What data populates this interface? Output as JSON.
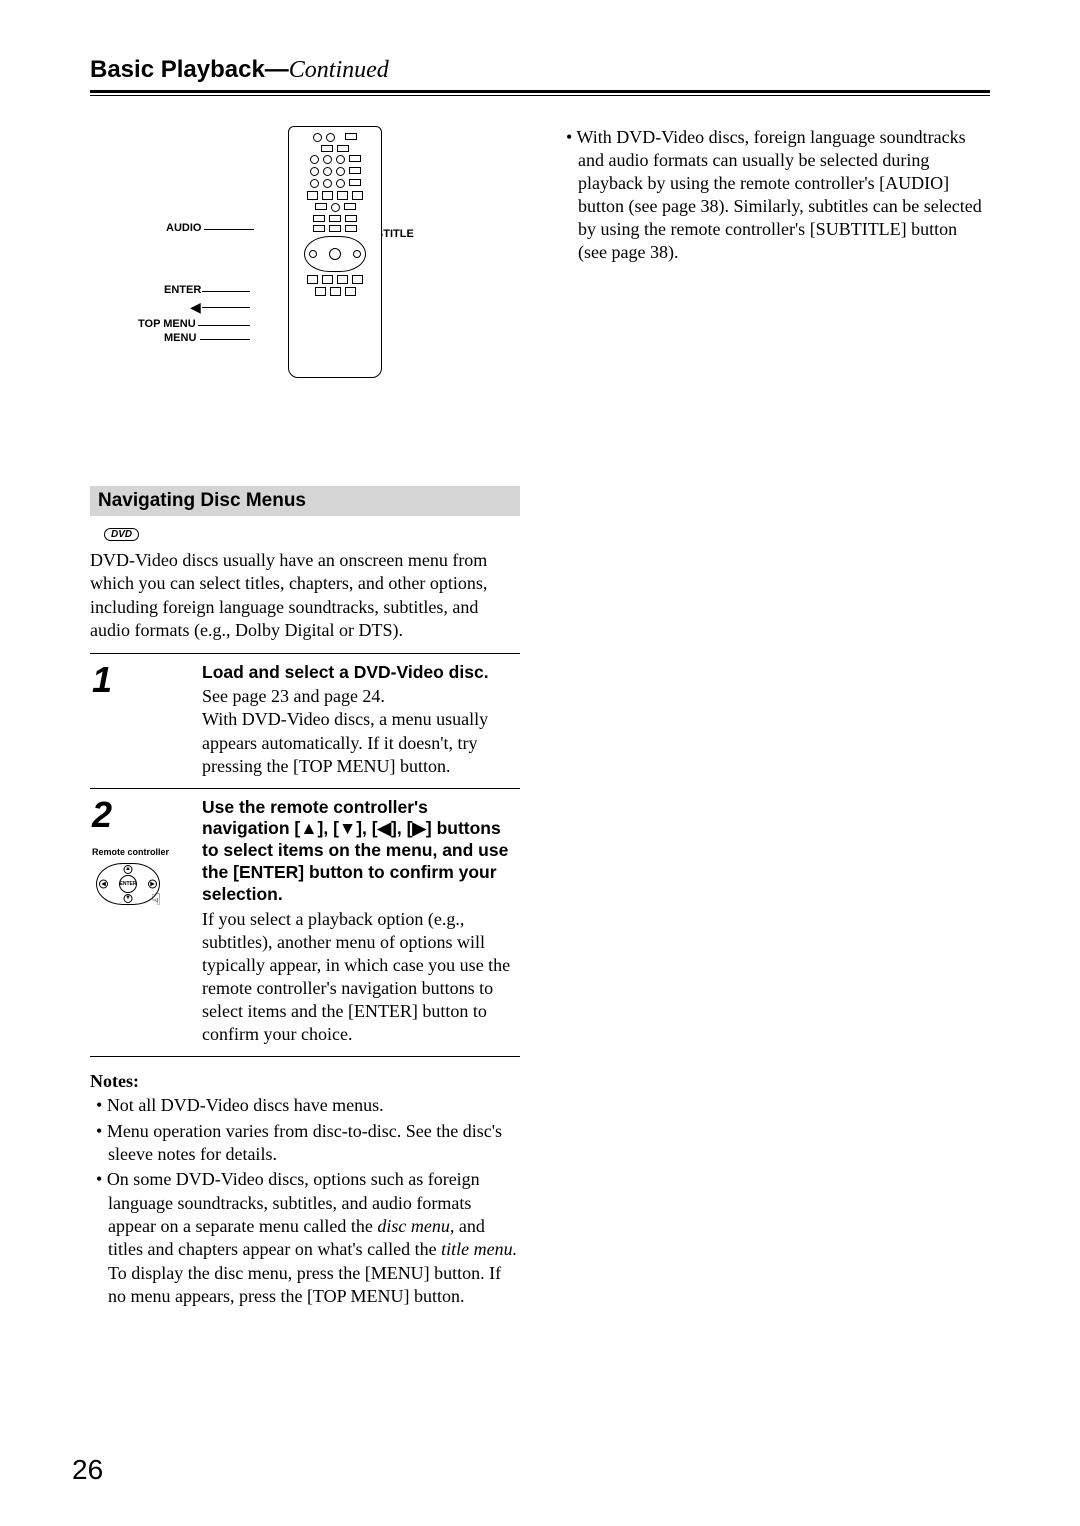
{
  "header": {
    "title_main": "Basic Playback",
    "title_sep": "—",
    "title_cont": "Continued"
  },
  "remote_labels": {
    "audio": "AUDIO",
    "subtitle": "SUBTITLE",
    "enter": "ENTER",
    "top_menu": "TOP MENU",
    "menu": "MENU"
  },
  "side_note_bullet": "•",
  "side_note": "With DVD-Video discs, foreign language soundtracks and audio formats can usually be selected during playback by using the remote controller's [AUDIO] button (see page 38). Similarly, subtitles can be selected by using the remote controller's [SUBTITLE] button (see page 38).",
  "section_title": "Navigating Disc Menus",
  "dvd_badge": "DVD",
  "intro": "DVD-Video discs usually have an onscreen menu from which you can select titles, chapters, and other options, including foreign language soundtracks, subtitles, and audio formats (e.g., Dolby Digital or DTS).",
  "steps": [
    {
      "num": "1",
      "head": "Load and select a DVD-Video disc.",
      "body": "See page 23 and page 24.\nWith DVD-Video discs, a menu usually appears automatically. If it doesn't, try pressing the [TOP MENU] button."
    },
    {
      "num": "2",
      "rc_label": "Remote controller",
      "head": "Use the remote controller's navigation [▲], [▼], [◀], [▶] buttons to select items on the menu, and use the [ENTER] button to confirm your selection.",
      "body": "If you select a playback option (e.g., subtitles), another menu of options will typically appear, in which case you use the remote controller's navigation buttons to select items and the [ENTER] button to confirm your choice."
    }
  ],
  "notes_title": "Notes:",
  "notes": [
    "Not all DVD-Video discs have menus.",
    "Menu operation varies from disc-to-disc. See the disc's sleeve notes for details.",
    "On some DVD-Video discs, options such as foreign language soundtracks, subtitles, and audio formats appear on a separate menu called the <i>disc menu,</i> and titles and chapters appear on what's called the <i>title menu.</i> To display the disc menu, press the [MENU] button. If no menu appears, press the [TOP MENU] button."
  ],
  "page_number": "26"
}
